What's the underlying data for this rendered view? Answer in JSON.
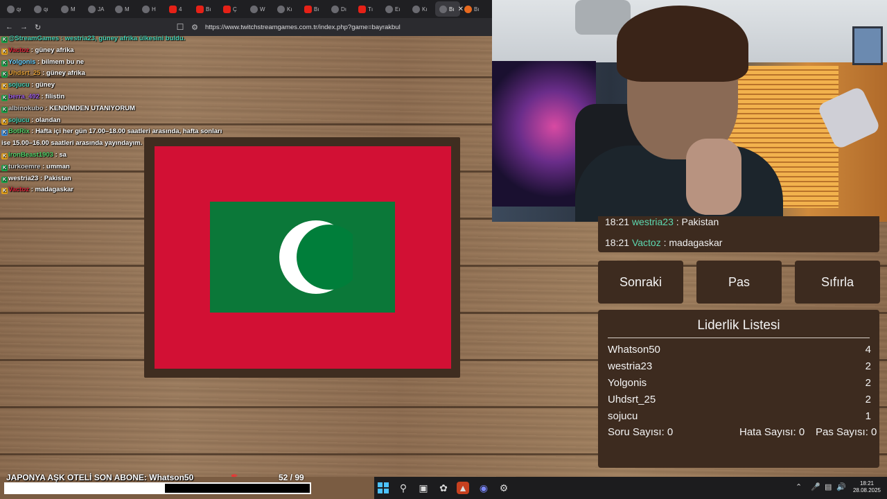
{
  "browser": {
    "tabs": [
      {
        "label": "qı",
        "icon": "game-icon"
      },
      {
        "label": "qı",
        "icon": "game-icon"
      },
      {
        "label": "M",
        "icon": "globe-icon"
      },
      {
        "label": "JA",
        "icon": "globe-icon"
      },
      {
        "label": "M",
        "icon": "globe-icon"
      },
      {
        "label": "H",
        "icon": "globe-icon"
      },
      {
        "label": "4",
        "icon": "youtube-icon"
      },
      {
        "label": "Bı",
        "icon": "youtube-icon"
      },
      {
        "label": "Ç",
        "icon": "youtube-icon"
      },
      {
        "label": "W",
        "icon": "globe-icon"
      },
      {
        "label": "Kı",
        "icon": "globe-icon"
      },
      {
        "label": "Bı",
        "icon": "youtube-icon"
      },
      {
        "label": "Dı",
        "icon": "globe-icon"
      },
      {
        "label": "Tı",
        "icon": "youtube-icon"
      },
      {
        "label": "Eı",
        "icon": "game-icon"
      },
      {
        "label": "Kı",
        "icon": "game-icon"
      },
      {
        "label": "Bı",
        "icon": "game-icon",
        "active": true
      },
      {
        "label": "Bı",
        "icon": "brave-icon"
      }
    ],
    "url": "https://www.twitchstreamgames.com.tr/index.php?game=bayrakbul"
  },
  "chat_overlay": [
    {
      "user": "",
      "text": "@StreamGames : westria23, güney afrika ülkesini buldu.",
      "color": "#46d3b8"
    },
    {
      "user": "Vactoz",
      "text": " : güney afrika",
      "color": "#e0243a"
    },
    {
      "user": "Yolgonis",
      "text": " : bilmem bu ne",
      "color": "#6ad1ff"
    },
    {
      "user": "Uhdsrt_25",
      "text": " : güney afrika",
      "color": "#e8a33a"
    },
    {
      "user": "sojucu",
      "text": " : güney",
      "color": "#46d3b8"
    },
    {
      "user": "berra_492",
      "text": " : filistin",
      "color": "#a05fe8"
    },
    {
      "user": "albinokubo",
      "text": " : KENDİMDEN UTANIYORUM",
      "color": "#c8c8c8"
    },
    {
      "user": "sojucu",
      "text": " : olandan",
      "color": "#46d3b8"
    },
    {
      "user": "BotRix",
      "text": " : Hafta içi her gün 17.00–18.00 saatleri arasında, hafta sonları",
      "color": "#53d36b"
    },
    {
      "user": "",
      "text": "ise 15.00–16.00 saatleri arasında yayındayım.",
      "color": "#ffffff"
    },
    {
      "user": "IronBeast1903",
      "text": " : sa",
      "color": "#53d36b"
    },
    {
      "user": "turkoemre",
      "text": " : umman",
      "color": "#d0d0d0"
    },
    {
      "user": "westria23",
      "text": " : Pakistan",
      "color": "#ffffff"
    },
    {
      "user": "Vactoz",
      "text": " : madagaskar",
      "color": "#e0243a"
    }
  ],
  "game": {
    "flag": {
      "country_colors": {
        "red": "#d21034",
        "green": "#007e3a",
        "crescent": "#ffffff"
      }
    },
    "chat": [
      {
        "time": "18:21",
        "user": "westria23",
        "text": ": Pakistan"
      },
      {
        "time": "18:21",
        "user": "Vactoz",
        "text": ": madagaskar"
      }
    ],
    "buttons": {
      "next": "Sonraki",
      "pass": "Pas",
      "reset": "Sıfırla"
    },
    "leaderboard": {
      "title": "Liderlik Listesi",
      "rows": [
        {
          "name": "Whatson50",
          "score": "4"
        },
        {
          "name": "westria23",
          "score": "2"
        },
        {
          "name": "Yolgonis",
          "score": "2"
        },
        {
          "name": "Uhdsrt_25",
          "score": "2"
        },
        {
          "name": "sojucu",
          "score": "1"
        }
      ],
      "question_label": "Soru Sayısı:",
      "question_count": "0",
      "error_label": "Hata Sayısı:",
      "error_count": "0",
      "pass_label": "Pas Sayısı:",
      "pass_count": "0"
    }
  },
  "stream_bar": {
    "text": "JAPONYA AŞK OTELİ   SON ABONE: Whatson50",
    "count": "52  / 99",
    "progress": 0.525
  },
  "taskbar": {
    "time": "18:21",
    "date": "28.08.2025"
  }
}
